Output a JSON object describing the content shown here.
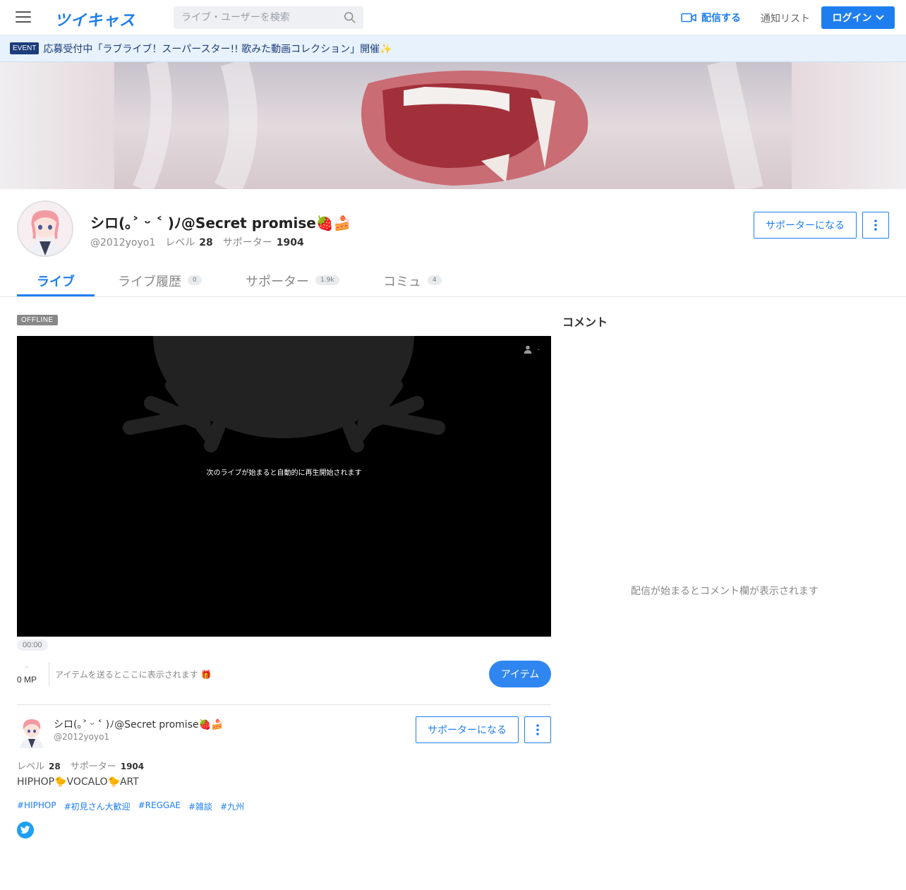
{
  "header": {
    "logo": "ツイキャス",
    "search_placeholder": "ライブ・ユーザーを検索",
    "broadcast_label": "配信する",
    "notify_label": "通知リスト",
    "login_label": "ログイン"
  },
  "event": {
    "badge": "EVENT",
    "text": "応募受付中「ラブライブ！スーパースター!! 歌みた動画コレクション」開催✨"
  },
  "profile": {
    "name": "シロ(｡˃ ᵕ ˂ )ﾉ@Secret promise🍓🍰",
    "handle": "@2012yoyo1",
    "level_label": "レベル",
    "level": "28",
    "supporter_label": "サポーター",
    "supporters": "1904",
    "support_button": "サポーターになる"
  },
  "tabs": [
    {
      "label": "ライブ",
      "count": ""
    },
    {
      "label": "ライブ履歴",
      "count": "0"
    },
    {
      "label": "サポーター",
      "count": "1.9k"
    },
    {
      "label": "コミュ",
      "count": "4"
    }
  ],
  "player": {
    "status": "OFFLINE",
    "message": "次のライブが始まると自動的に再生開始されます",
    "viewers": "-",
    "time": "00:00"
  },
  "items": {
    "mp_dash": "-",
    "mp": "0 MP",
    "message": "アイテムを送るとここに表示されます 🎁",
    "button": "アイテム"
  },
  "card": {
    "name": "シロ(｡˃ ᵕ ˂ )ﾉ@Secret promise🍓🍰",
    "handle": "@2012yoyo1",
    "level_label": "レベル",
    "level": "28",
    "supporter_label": "サポーター",
    "supporters": "1904",
    "support_button": "サポーターになる",
    "bio": "HIPHOP🐤VOCALO🐤ART",
    "tags": [
      "#HIPHOP",
      "#初見さん大歓迎",
      "#REGGAE",
      "#雑談",
      "#九州"
    ]
  },
  "comments": {
    "title": "コメント",
    "empty": "配信が始まるとコメント欄が表示されます"
  },
  "colors": {
    "accent": "#1e7ef0",
    "event_bg": "#e8f2fc",
    "twitter": "#1da1f2"
  }
}
